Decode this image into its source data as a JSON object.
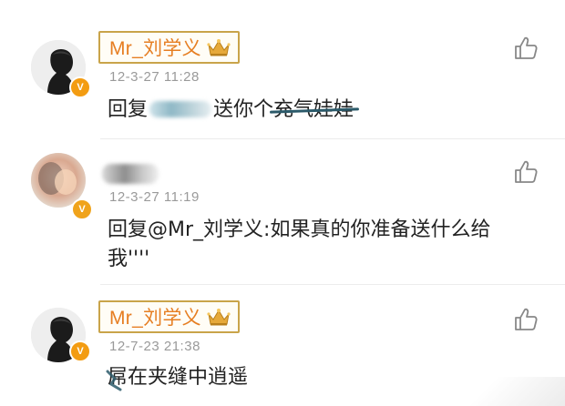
{
  "comments": [
    {
      "username": "Mr_刘学义",
      "timestamp": "12-3-27 11:28",
      "reply_prefix": "回复",
      "reply_suffix": "送你个",
      "struck_text": "充气娃娃",
      "icons": {
        "avatar": "avatar-silhouette-icon",
        "verified": "v-badge-icon",
        "crown": "crown-icon",
        "like": "thumbs-up-icon"
      }
    },
    {
      "timestamp": "12-3-27 11:19",
      "reply_line1": "回复@Mr_刘学义:如果真的你准备送什么给",
      "reply_line2": "我''''",
      "icons": {
        "avatar": "avatar-blurred-icon",
        "like": "thumbs-up-icon"
      }
    },
    {
      "username": "Mr_刘学义",
      "timestamp": "12-7-23 21:38",
      "reply_text": "屌在夹缝中逍遥",
      "icons": {
        "avatar": "avatar-silhouette-icon",
        "verified": "v-badge-icon",
        "crown": "crown-icon",
        "like": "thumbs-up-icon"
      }
    }
  ],
  "badge_letter": "V",
  "colors": {
    "username": "#e67e22",
    "timestamp": "#9a9a9a",
    "badge": "#f39c12",
    "name_border": "#c9a44a",
    "strike": "#2b5a6a"
  }
}
